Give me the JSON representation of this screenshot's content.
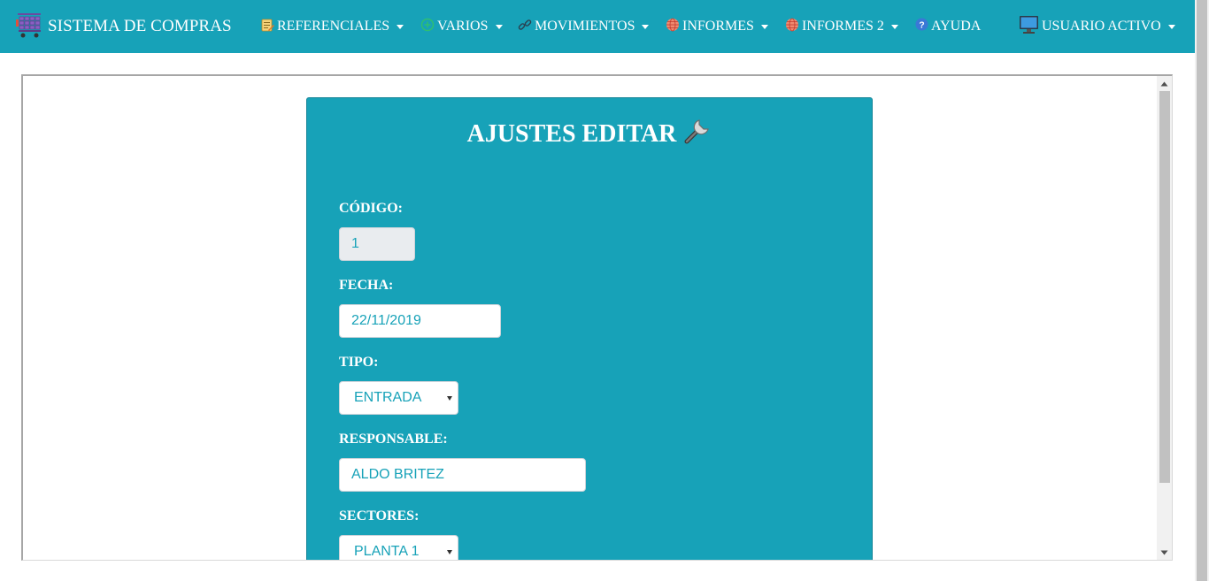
{
  "navbar": {
    "brand": "SISTEMA DE COMPRAS",
    "menus": [
      {
        "label": "REFERENCIALES",
        "icon": "clipboard-icon",
        "dropdown": true
      },
      {
        "label": "VARIOS",
        "icon": "plus-circle-icon",
        "dropdown": true
      },
      {
        "label": "MOVIMIENTOS",
        "icon": "link-icon",
        "dropdown": true
      },
      {
        "label": "INFORMES",
        "icon": "globe-icon",
        "dropdown": true
      },
      {
        "label": "INFORMES 2",
        "icon": "globe-icon",
        "dropdown": true
      },
      {
        "label": "AYUDA",
        "icon": "help-icon",
        "dropdown": false
      },
      {
        "label": "USUARIO ACTIVO",
        "icon": "monitor-icon",
        "dropdown": true
      }
    ]
  },
  "form": {
    "title": "AJUSTES EDITAR",
    "codigo": {
      "label": "CÓDIGO:",
      "value": "1"
    },
    "fecha": {
      "label": "FECHA:",
      "value": "22/11/2019"
    },
    "tipo": {
      "label": "TIPO:",
      "selected": "ENTRADA"
    },
    "responsable": {
      "label": "RESPONSABLE:",
      "value": "ALDO BRITEZ"
    },
    "sectores": {
      "label": "SECTORES:",
      "selected": "PLANTA 1"
    }
  },
  "colors": {
    "navbar": "#17a2b8",
    "card": "#17a2b8",
    "input_text": "#17a2b8",
    "disabled_input": "#e9ecef"
  }
}
